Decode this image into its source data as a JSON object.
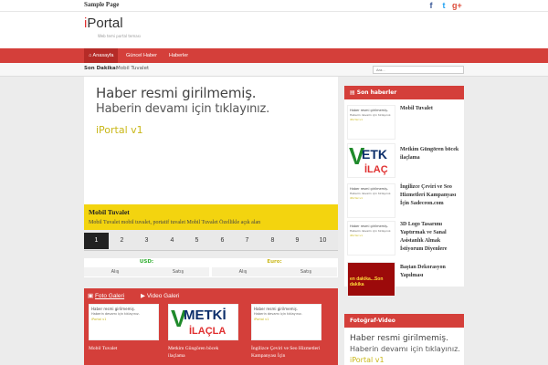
{
  "topbar": {
    "sample_page": "Sample Page",
    "social": [
      {
        "icon": "facebook-icon",
        "glyph": "f",
        "color": "#3b5998"
      },
      {
        "icon": "twitter-icon",
        "glyph": "t",
        "color": "#1da1f2"
      },
      {
        "icon": "google-plus-icon",
        "glyph": "g+",
        "color": "#dd4b39"
      }
    ]
  },
  "header": {
    "logo_first": "i",
    "logo_rest": "Portal",
    "tagline": "Web temi portal teması"
  },
  "nav": {
    "home": "Anasayfa",
    "items": [
      "Güncel Haber",
      "Haberler"
    ],
    "home_icon": "home-icon"
  },
  "breaking": {
    "label": "Son Dakika:",
    "text": "Mobil Tuvalet",
    "search_placeholder": "Ara..."
  },
  "slider": {
    "line1": "Haber resmi girilmemiş.",
    "line2": "Haberin devamı için tıklayınız.",
    "line3": "iPortal v1",
    "caption_title": "Mobil Tuvalet",
    "caption_desc": "Mobil Tuvalet mobil tuvalet, portatif tuvalet Mobil Tuvalet   Özellikle açık alan",
    "pages": [
      "1",
      "2",
      "3",
      "4",
      "5",
      "6",
      "7",
      "8",
      "9",
      "10"
    ],
    "active_page": "1"
  },
  "currency": {
    "usd": {
      "name": "USD:",
      "buy": "Alış",
      "sell": "Satış"
    },
    "euro": {
      "name": "Euro:",
      "buy": "Alış",
      "sell": "Satış"
    }
  },
  "gallery": {
    "tab_photo": "Foto Galeri",
    "tab_video": "Video Galeri",
    "photo_icon": "camera-icon",
    "video_icon": "video-icon",
    "placeholder": {
      "line1": "Haber resmi girilmemiş.",
      "line2": "Haberin devamı için tıklayınız.",
      "line3": "iPortal v1"
    },
    "metkim": {
      "m": "METKİ",
      "il": "İLAÇLA"
    },
    "captions": [
      "Mobil Tuvalet",
      "Metkim Güngören böcek ilaçlama",
      "İngilizce Çeviri ve Seo Hizmetleri Kampanyası İçin"
    ]
  },
  "sidebar": {
    "title": "Son haberler",
    "title_icon": "news-icon",
    "placeholder": {
      "line1": "Haber resmi girilmemiş.",
      "line2": "Haberin devamı için tıklayınız.",
      "line3": "iPortal v1"
    },
    "metkim": {
      "m": "ETK",
      "il": "İLAÇ"
    },
    "dakika": "en dakika...Son dakika",
    "items": [
      "Mobil Tuvalet",
      "Metkim Güngören böcek ilaçlama",
      "İngilizce Çeviri ve Seo Hizmetleri Kampanyası İçin Sadeceon.com",
      "3D Logo Tasarımı Yaptırmak ve Sanal Asistanlık Almak İstiyorum Diyenlere",
      "Baştan Dekorasyon Yapılması"
    ]
  },
  "sidebar2": {
    "title": "Fotoğraf-Video",
    "line1": "Haber resmi girilmemiş.",
    "line2": "Haberin devamı için tıklayınız.",
    "line3": "iPortal v1"
  }
}
